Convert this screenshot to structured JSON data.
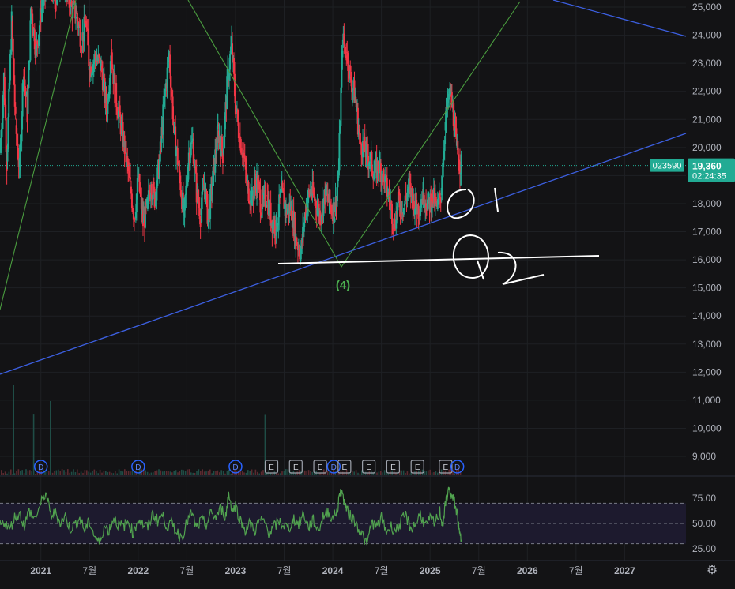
{
  "chart_data": [
    {
      "type": "line",
      "title": "",
      "symbol": "023590",
      "last_price": "19,360",
      "countdown": "02:24:35",
      "price_ticks": [
        "25,000",
        "24,000",
        "23,000",
        "22,000",
        "21,000",
        "20,000",
        "19,000",
        "18,000",
        "17,000",
        "16,000",
        "15,000",
        "14,000",
        "13,000",
        "12,000",
        "11,000",
        "10,000",
        "9,000"
      ],
      "ylim": [
        8600,
        25200
      ],
      "x_ticks": [
        "2021",
        "7월",
        "2022",
        "7월",
        "2023",
        "7월",
        "2024",
        "7월",
        "2025",
        "7월",
        "2026",
        "7월",
        "2027"
      ],
      "x_range": [
        2020.58,
        2027.63
      ],
      "series": [
        {
          "values": [
            [
              2020.58,
              19800
            ],
            [
              2020.62,
              22500
            ],
            [
              2020.65,
              19500
            ],
            [
              2020.7,
              24500
            ],
            [
              2020.74,
              20800
            ],
            [
              2020.78,
              19200
            ],
            [
              2020.82,
              22800
            ],
            [
              2020.86,
              21200
            ],
            [
              2020.9,
              25000
            ],
            [
              2020.95,
              23400
            ],
            [
              2021.0,
              24800
            ],
            [
              2021.08,
              26000
            ],
            [
              2021.15,
              25200
            ],
            [
              2021.22,
              26400
            ],
            [
              2021.3,
              25000
            ],
            [
              2021.36,
              24800
            ],
            [
              2021.42,
              23800
            ],
            [
              2021.46,
              24500
            ],
            [
              2021.5,
              22800
            ],
            [
              2021.56,
              23200
            ],
            [
              2021.62,
              22900
            ],
            [
              2021.68,
              21200
            ],
            [
              2021.72,
              23500
            ],
            [
              2021.76,
              22000
            ],
            [
              2021.82,
              20800
            ],
            [
              2021.86,
              20000
            ],
            [
              2021.92,
              18600
            ],
            [
              2021.96,
              17500
            ],
            [
              2022.0,
              18900
            ],
            [
              2022.05,
              17300
            ],
            [
              2022.09,
              17800
            ],
            [
              2022.13,
              18700
            ],
            [
              2022.17,
              18200
            ],
            [
              2022.22,
              19500
            ],
            [
              2022.27,
              21800
            ],
            [
              2022.32,
              23300
            ],
            [
              2022.37,
              20500
            ],
            [
              2022.42,
              19200
            ],
            [
              2022.47,
              17500
            ],
            [
              2022.52,
              19800
            ],
            [
              2022.56,
              20200
            ],
            [
              2022.6,
              18400
            ],
            [
              2022.64,
              17600
            ],
            [
              2022.68,
              18700
            ],
            [
              2022.72,
              17400
            ],
            [
              2022.77,
              19000
            ],
            [
              2022.82,
              20600
            ],
            [
              2022.87,
              19800
            ],
            [
              2022.92,
              22500
            ],
            [
              2022.96,
              23700
            ],
            [
              2023.0,
              21500
            ],
            [
              2023.04,
              20400
            ],
            [
              2023.08,
              19800
            ],
            [
              2023.12,
              18600
            ],
            [
              2023.17,
              18200
            ],
            [
              2023.22,
              18900
            ],
            [
              2023.27,
              17800
            ],
            [
              2023.32,
              18300
            ],
            [
              2023.37,
              17400
            ],
            [
              2023.42,
              17200
            ],
            [
              2023.47,
              18400
            ],
            [
              2023.52,
              17800
            ],
            [
              2023.57,
              17900
            ],
            [
              2023.62,
              16800
            ],
            [
              2023.67,
              16200
            ],
            [
              2023.72,
              17800
            ],
            [
              2023.77,
              18500
            ],
            [
              2023.82,
              18100
            ],
            [
              2023.87,
              17600
            ],
            [
              2023.92,
              18300
            ],
            [
              2023.97,
              18000
            ],
            [
              2024.02,
              17700
            ],
            [
              2024.06,
              19200
            ],
            [
              2024.1,
              23800
            ],
            [
              2024.14,
              23400
            ],
            [
              2024.18,
              22500
            ],
            [
              2024.23,
              21800
            ],
            [
              2024.28,
              20200
            ],
            [
              2024.33,
              19900
            ],
            [
              2024.38,
              19600
            ],
            [
              2024.43,
              19100
            ],
            [
              2024.48,
              19400
            ],
            [
              2024.53,
              18800
            ],
            [
              2024.58,
              18200
            ],
            [
              2024.63,
              17300
            ],
            [
              2024.68,
              18100
            ],
            [
              2024.73,
              17900
            ],
            [
              2024.78,
              18600
            ],
            [
              2024.83,
              18100
            ],
            [
              2024.88,
              17800
            ],
            [
              2024.93,
              18400
            ],
            [
              2024.98,
              18000
            ],
            [
              2025.03,
              18200
            ],
            [
              2025.07,
              17800
            ],
            [
              2025.11,
              18300
            ],
            [
              2025.15,
              20600
            ],
            [
              2025.18,
              21600
            ],
            [
              2025.21,
              21900
            ],
            [
              2025.24,
              21100
            ],
            [
              2025.27,
              20000
            ],
            [
              2025.3,
              19500
            ],
            [
              2025.32,
              19360
            ]
          ]
        }
      ],
      "volume_markers": [
        {
          "x": 2021.0,
          "label": "D"
        },
        {
          "x": 2022.0,
          "label": "D"
        },
        {
          "x": 2023.0,
          "label": "D"
        },
        {
          "x": 2023.37,
          "label": "E"
        },
        {
          "x": 2023.62,
          "label": "E"
        },
        {
          "x": 2023.87,
          "label": "E"
        },
        {
          "x": 2024.01,
          "label": "D"
        },
        {
          "x": 2024.12,
          "label": "E"
        },
        {
          "x": 2024.37,
          "label": "E"
        },
        {
          "x": 2024.62,
          "label": "E"
        },
        {
          "x": 2024.87,
          "label": "E"
        },
        {
          "x": 2025.16,
          "label": "E"
        },
        {
          "x": 2025.28,
          "label": "D"
        }
      ]
    },
    {
      "type": "line",
      "title": "",
      "ticks": [
        "75.00",
        "50.00",
        "25.00"
      ],
      "ylim": [
        18,
        87
      ],
      "bands": [
        70,
        50,
        30
      ],
      "series": [
        {
          "values": [
            [
              2020.58,
              48
            ],
            [
              2020.63,
              52
            ],
            [
              2020.68,
              44
            ],
            [
              2020.73,
              56
            ],
            [
              2020.78,
              60
            ],
            [
              2020.83,
              48
            ],
            [
              2020.88,
              63
            ],
            [
              2020.93,
              54
            ],
            [
              2021.0,
              69
            ],
            [
              2021.05,
              81
            ],
            [
              2021.1,
              58
            ],
            [
              2021.15,
              60
            ],
            [
              2021.2,
              51
            ],
            [
              2021.25,
              57
            ],
            [
              2021.3,
              45
            ],
            [
              2021.35,
              49
            ],
            [
              2021.4,
              55
            ],
            [
              2021.45,
              43
            ],
            [
              2021.5,
              52
            ],
            [
              2021.55,
              38
            ],
            [
              2021.6,
              30
            ],
            [
              2021.65,
              47
            ],
            [
              2021.7,
              43
            ],
            [
              2021.75,
              56
            ],
            [
              2021.8,
              48
            ],
            [
              2021.85,
              47
            ],
            [
              2021.9,
              52
            ],
            [
              2021.95,
              40
            ],
            [
              2022.0,
              55
            ],
            [
              2022.05,
              49
            ],
            [
              2022.1,
              46
            ],
            [
              2022.15,
              60
            ],
            [
              2022.2,
              53
            ],
            [
              2022.25,
              58
            ],
            [
              2022.3,
              47
            ],
            [
              2022.35,
              50
            ],
            [
              2022.4,
              41
            ],
            [
              2022.45,
              37
            ],
            [
              2022.5,
              51
            ],
            [
              2022.55,
              60
            ],
            [
              2022.6,
              45
            ],
            [
              2022.65,
              53
            ],
            [
              2022.7,
              49
            ],
            [
              2022.75,
              60
            ],
            [
              2022.8,
              56
            ],
            [
              2022.85,
              65
            ],
            [
              2022.9,
              57
            ],
            [
              2022.93,
              80
            ],
            [
              2022.97,
              62
            ],
            [
              2023.0,
              68
            ],
            [
              2023.05,
              53
            ],
            [
              2023.1,
              44
            ],
            [
              2023.15,
              50
            ],
            [
              2023.2,
              43
            ],
            [
              2023.25,
              53
            ],
            [
              2023.3,
              51
            ],
            [
              2023.35,
              40
            ],
            [
              2023.4,
              47
            ],
            [
              2023.45,
              52
            ],
            [
              2023.5,
              48
            ],
            [
              2023.55,
              45
            ],
            [
              2023.6,
              55
            ],
            [
              2023.65,
              49
            ],
            [
              2023.7,
              60
            ],
            [
              2023.75,
              46
            ],
            [
              2023.8,
              53
            ],
            [
              2023.85,
              43
            ],
            [
              2023.9,
              57
            ],
            [
              2023.95,
              62
            ],
            [
              2024.0,
              55
            ],
            [
              2024.05,
              64
            ],
            [
              2024.08,
              85
            ],
            [
              2024.12,
              71
            ],
            [
              2024.16,
              59
            ],
            [
              2024.2,
              56
            ],
            [
              2024.25,
              48
            ],
            [
              2024.3,
              40
            ],
            [
              2024.35,
              28
            ],
            [
              2024.4,
              52
            ],
            [
              2024.45,
              46
            ],
            [
              2024.5,
              55
            ],
            [
              2024.55,
              42
            ],
            [
              2024.6,
              47
            ],
            [
              2024.65,
              43
            ],
            [
              2024.7,
              51
            ],
            [
              2024.75,
              58
            ],
            [
              2024.8,
              45
            ],
            [
              2024.85,
              49
            ],
            [
              2024.9,
              60
            ],
            [
              2024.95,
              47
            ],
            [
              2025.0,
              54
            ],
            [
              2025.05,
              50
            ],
            [
              2025.1,
              62
            ],
            [
              2025.13,
              48
            ],
            [
              2025.16,
              70
            ],
            [
              2025.19,
              86
            ],
            [
              2025.22,
              76
            ],
            [
              2025.25,
              72
            ],
            [
              2025.28,
              58
            ],
            [
              2025.3,
              40
            ],
            [
              2025.32,
              34
            ]
          ]
        }
      ]
    }
  ],
  "colors": {
    "background": "#131315",
    "grid": "#1e2024",
    "up": "#22ab94",
    "down": "#f23645",
    "price_line": "#22ab94",
    "trend_blue": "#3c5fe0",
    "trend_green": "#4a9c3f",
    "rsi_line": "#51a24f",
    "rsi_band": "#1d1a2e",
    "marker_blue": "#2962ff",
    "marker_gray": "#9ea3ad"
  },
  "annotations": {
    "wave_label": "(4)",
    "handwritten": [
      "①",
      "②"
    ]
  },
  "icons": {
    "settings": "gear-icon"
  }
}
